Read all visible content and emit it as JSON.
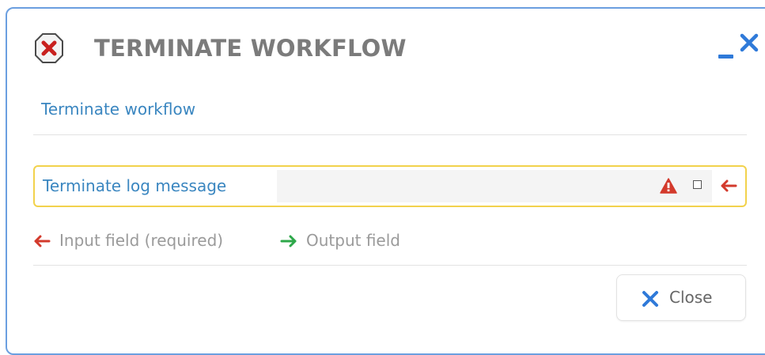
{
  "dialog": {
    "title": "TERMINATE WORKFLOW",
    "title_icon": "x-in-octagon-icon",
    "minimize_icon": "minimize-icon",
    "close_icon": "close-icon",
    "subtitle": "Terminate workflow"
  },
  "field": {
    "label": "Terminate log message",
    "value": "",
    "placeholder": "",
    "warning_icon": "warning-triangle-icon",
    "checkbox_checked": false,
    "required_icon": "left-arrow-icon"
  },
  "legend": {
    "input_label": "Input field (required)",
    "output_label": "Output field",
    "input_icon": "left-arrow-icon",
    "output_icon": "right-arrow-icon"
  },
  "footer": {
    "close_label": "Close",
    "close_icon": "x-icon"
  },
  "colors": {
    "border": "#6b9fe0",
    "accent_blue": "#2f7ad9",
    "label_blue": "#3a86c0",
    "title_gray": "#7b7b7b",
    "required_red": "#d33a2c",
    "output_green": "#2ea84a",
    "field_highlight": "#f2d24c"
  }
}
